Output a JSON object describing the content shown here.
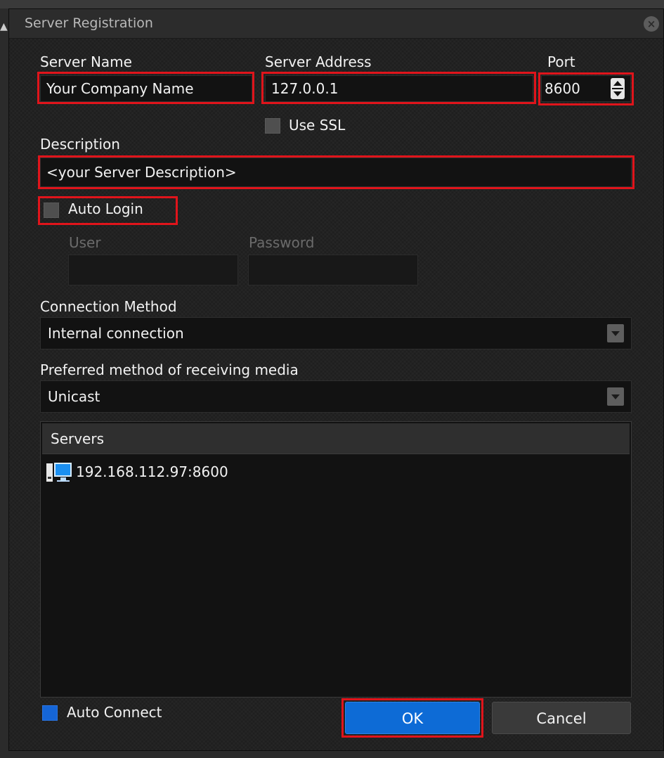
{
  "window": {
    "title": "Server Registration"
  },
  "form": {
    "server_name_label": "Server Name",
    "server_name_value": "Your Company Name",
    "server_address_label": "Server Address",
    "server_address_value": "127.0.0.1",
    "port_label": "Port",
    "port_value": "8600",
    "use_ssl_label": "Use SSL",
    "use_ssl_checked": false,
    "description_label": "Description",
    "description_value": "<your Server Description>",
    "auto_login_label": "Auto Login",
    "auto_login_checked": false,
    "user_label": "User",
    "user_value": "",
    "password_label": "Password",
    "password_value": "",
    "connection_method_label": "Connection Method",
    "connection_method_value": "Internal connection",
    "media_method_label": "Preferred method of receiving media",
    "media_method_value": "Unicast"
  },
  "servers": {
    "header": "Servers",
    "items": [
      {
        "address": "192.168.112.97:8600",
        "icon": "server-computer-icon"
      }
    ]
  },
  "footer": {
    "auto_connect_label": "Auto Connect",
    "auto_connect_checked": true,
    "ok_label": "OK",
    "cancel_label": "Cancel"
  },
  "colors": {
    "highlight": "#e0141b",
    "accent": "#0d6bd6",
    "background": "#222222"
  }
}
